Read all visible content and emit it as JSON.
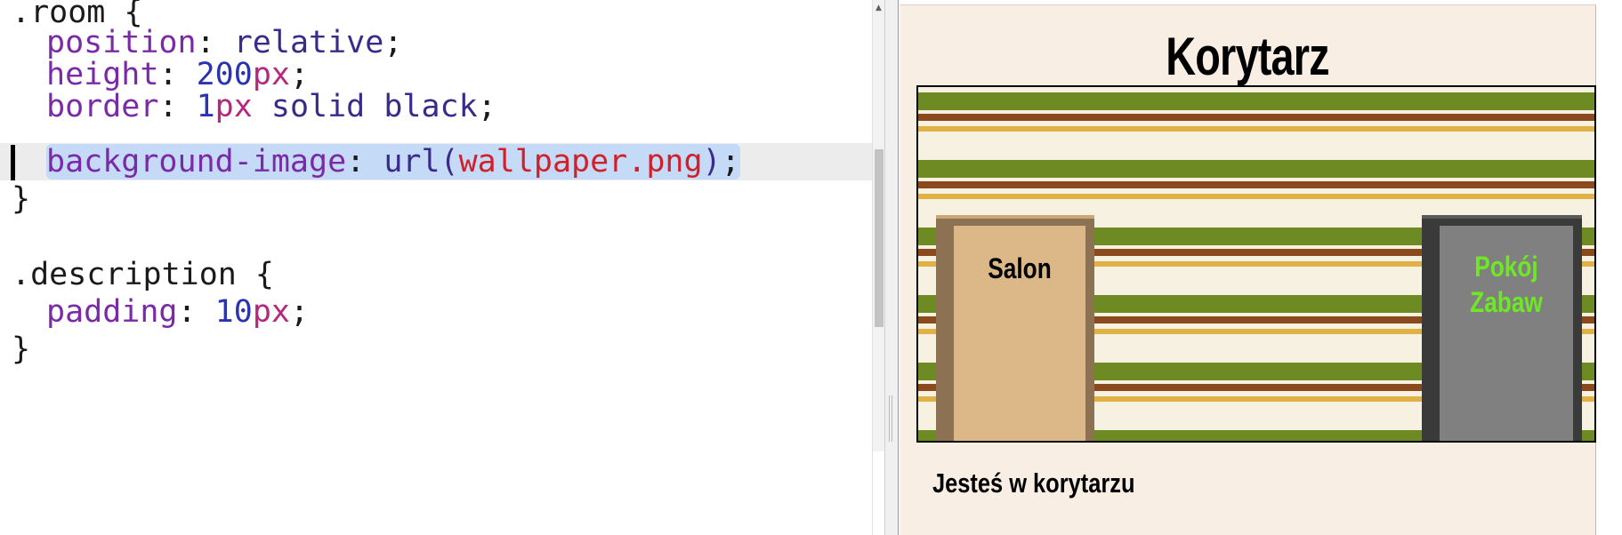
{
  "editor": {
    "lines": [
      {
        "parts": [
          {
            "cls": "punct",
            "text": ".room {"
          }
        ]
      },
      {
        "parts": [
          {
            "cls": "prop",
            "text": "position"
          },
          {
            "cls": "punct",
            "text": ": "
          },
          {
            "cls": "kw",
            "text": "relative"
          },
          {
            "cls": "punct",
            "text": ";"
          }
        ]
      },
      {
        "parts": [
          {
            "cls": "prop",
            "text": "height"
          },
          {
            "cls": "punct",
            "text": ": "
          },
          {
            "cls": "num",
            "text": "200"
          },
          {
            "cls": "unit",
            "text": "px"
          },
          {
            "cls": "punct",
            "text": ";"
          }
        ]
      },
      {
        "parts": [
          {
            "cls": "prop",
            "text": "border"
          },
          {
            "cls": "punct",
            "text": ": "
          },
          {
            "cls": "num",
            "text": "1"
          },
          {
            "cls": "unit",
            "text": "px"
          },
          {
            "cls": "kw",
            "text": " solid black"
          },
          {
            "cls": "punct",
            "text": ";"
          }
        ]
      },
      {
        "parts": [
          {
            "cls": "prop",
            "text": "background-image"
          },
          {
            "cls": "punct",
            "text": ": "
          },
          {
            "cls": "kw",
            "text": "url("
          },
          {
            "cls": "str",
            "text": "wallpaper.png"
          },
          {
            "cls": "kw",
            "text": ")"
          },
          {
            "cls": "punct",
            "text": ";"
          }
        ]
      },
      {
        "parts": [
          {
            "cls": "punct",
            "text": "}"
          }
        ]
      },
      {
        "parts": []
      },
      {
        "parts": [
          {
            "cls": "punct",
            "text": ".description {"
          }
        ]
      },
      {
        "parts": [
          {
            "cls": "prop",
            "text": "padding"
          },
          {
            "cls": "punct",
            "text": ": "
          },
          {
            "cls": "num",
            "text": "10"
          },
          {
            "cls": "unit",
            "text": "px"
          },
          {
            "cls": "punct",
            "text": ";"
          }
        ]
      },
      {
        "parts": [
          {
            "cls": "punct",
            "text": "}"
          }
        ]
      }
    ],
    "active_line": 4
  },
  "scrollbar": {
    "up_arrow": "▲"
  },
  "preview": {
    "title": "Korytarz",
    "doors": {
      "salon": "Salon",
      "playroom_line1": "Pokój",
      "playroom_line2": "Zabaw"
    },
    "description": "Jesteś w korytarzu"
  },
  "colors": {
    "wallpaper_green": "#6e8a23",
    "wallpaper_brown": "#8b4a1d",
    "wallpaper_gold": "#e0b245",
    "playroom_label": "#6ee825",
    "page_background": "#f8eee4"
  }
}
